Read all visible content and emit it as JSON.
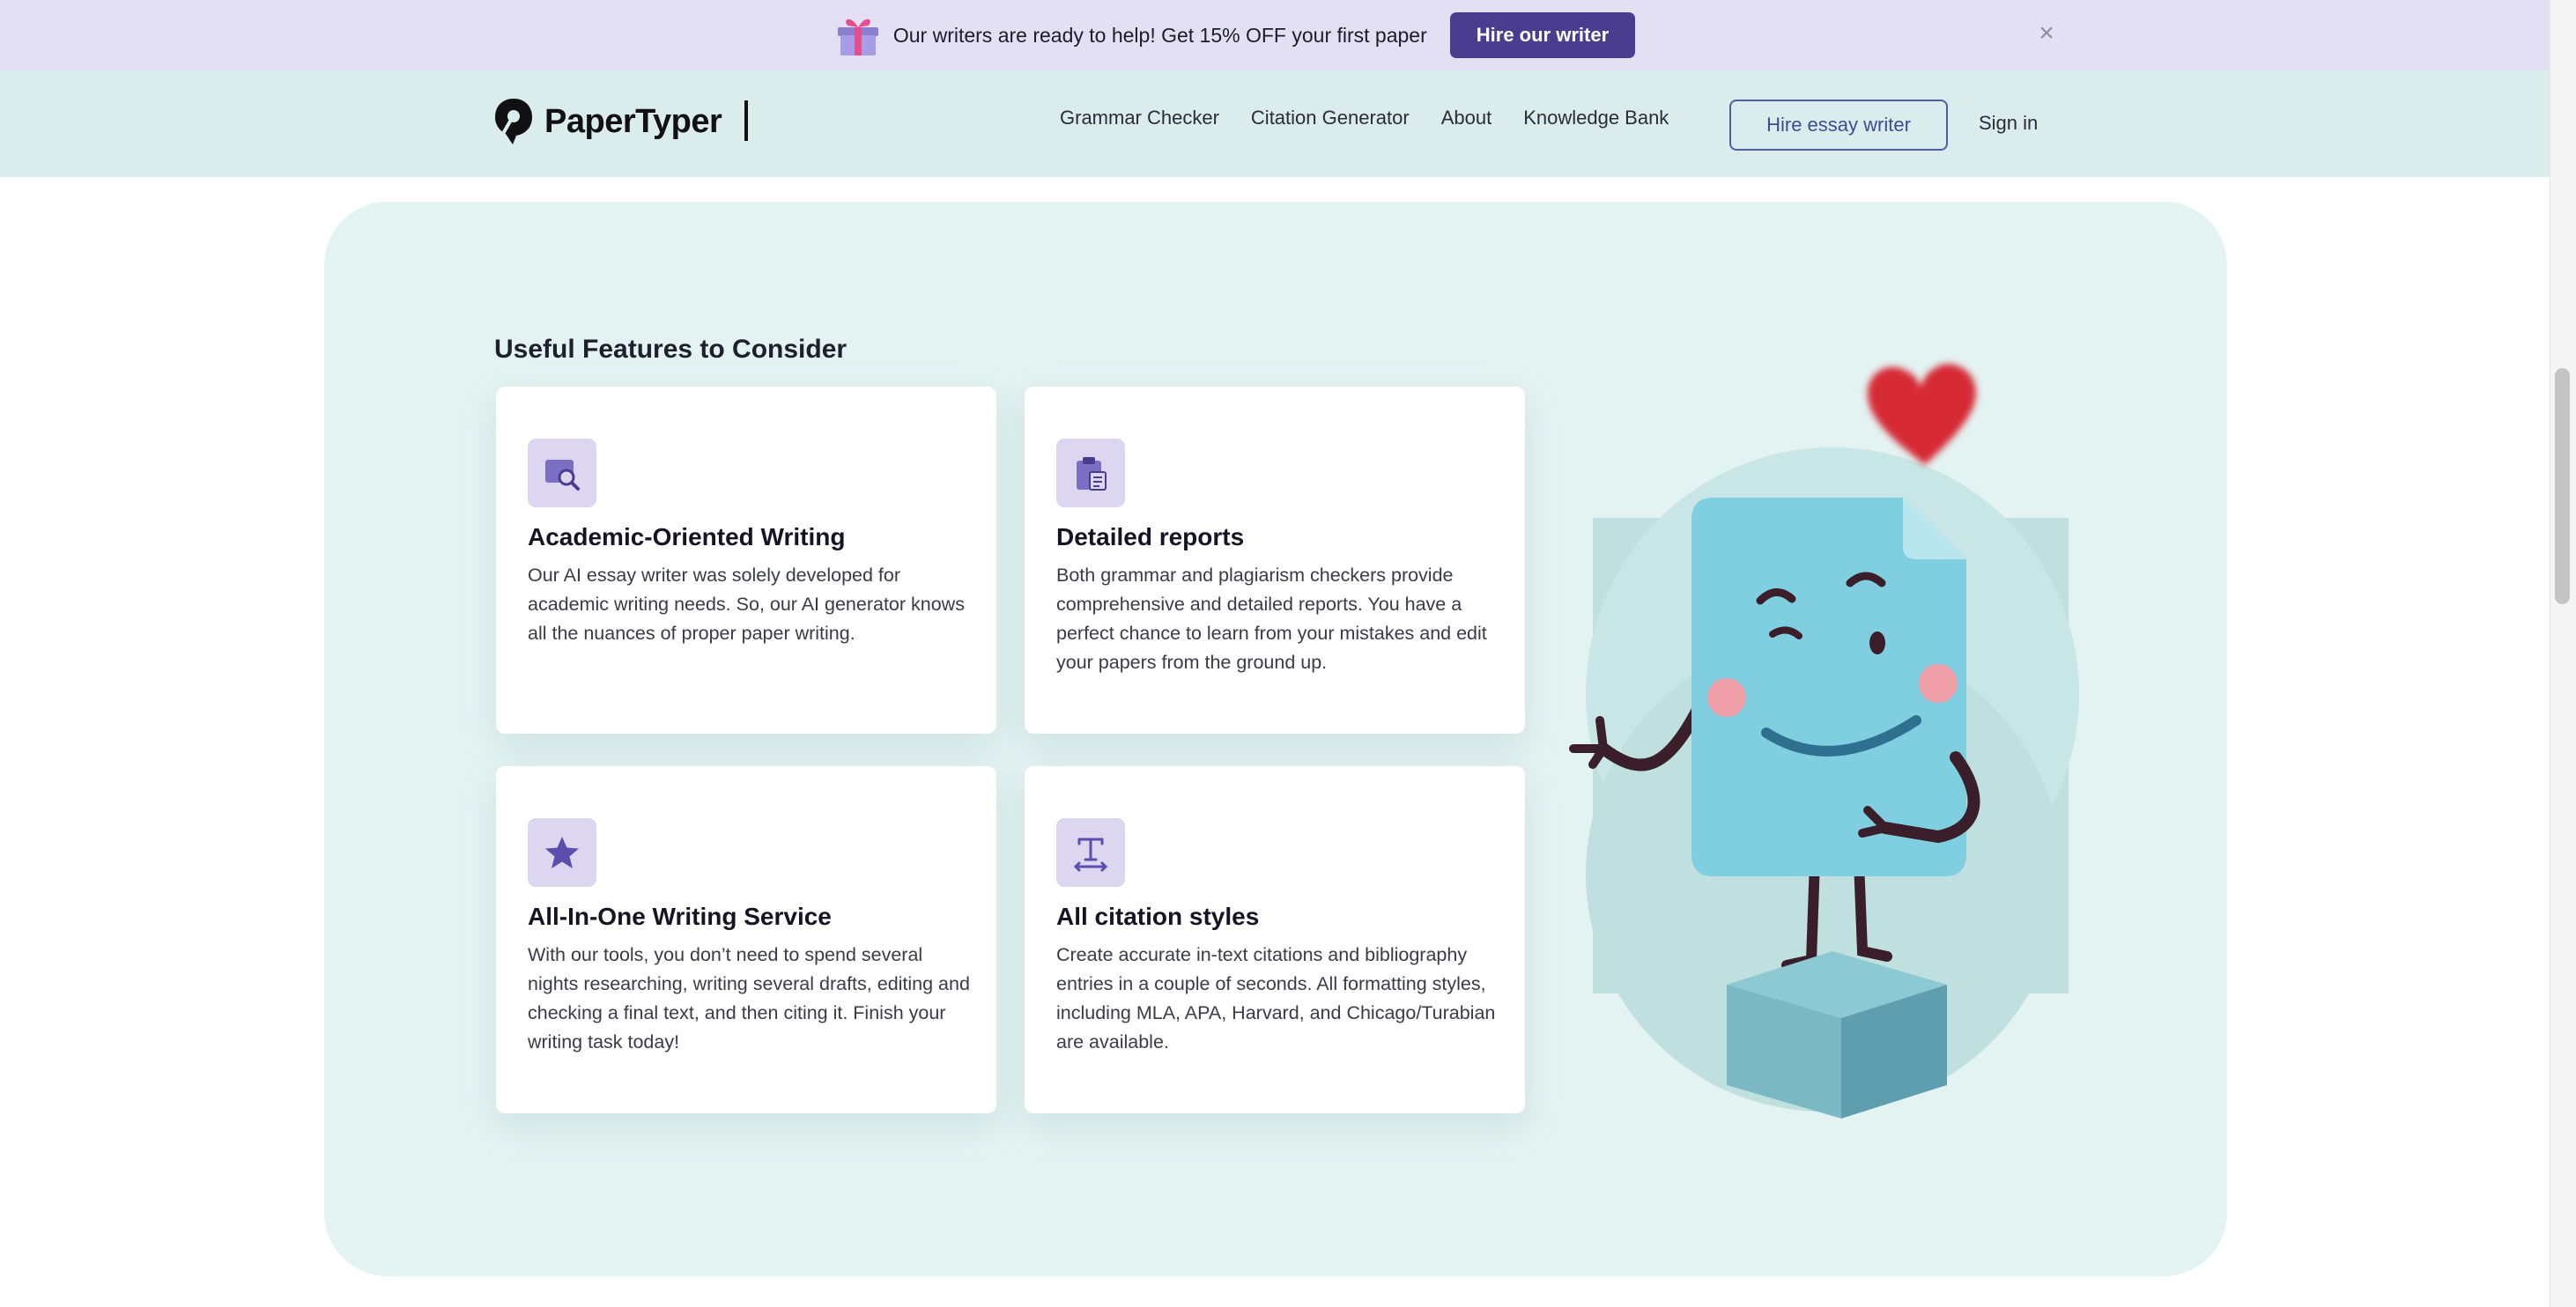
{
  "promo": {
    "message": "Our writers are ready to help! Get 15% OFF your first paper",
    "button_label": "Hire our writer",
    "close_glyph": "×",
    "gift_icon": "gift-icon"
  },
  "header": {
    "logo_text": "PaperTyper",
    "nav": [
      "Grammar Checker",
      "Citation Generator",
      "About",
      "Knowledge Bank"
    ],
    "hire_label": "Hire essay writer",
    "signin_label": "Sign in"
  },
  "features": {
    "title": "Useful Features to Consider",
    "cards": [
      {
        "icon": "search-document-icon",
        "title": "Academic-Oriented Writing",
        "text": "Our AI essay writer was solely developed for academic writing needs. So, our AI generator knows all the nuances of proper paper writing."
      },
      {
        "icon": "clipboard-icon",
        "title": "Detailed reports",
        "text": "Both grammar and plagiarism checkers provide comprehensive and detailed reports. You have a perfect chance to learn from your mistakes and edit your papers from the ground up."
      },
      {
        "icon": "star-icon",
        "title": "All-In-One Writing Service",
        "text": "With our tools, you don’t need to spend several nights researching, writing several drafts, editing and checking a final text, and then citing it. Finish your writing task today!"
      },
      {
        "icon": "text-format-icon",
        "title": "All citation styles",
        "text": "Create accurate in-text citations and bibliography entries in a couple of seconds. All formatting styles, including MLA, APA, Harvard, and Chicago/Turabian are available."
      }
    ]
  },
  "colors": {
    "promo_bg": "#e4e0f3",
    "header_bg": "#dbecec",
    "panel_bg": "#e3f3f2",
    "accent": "#4a3d8f",
    "icon_tile": "#dcd6f1"
  }
}
